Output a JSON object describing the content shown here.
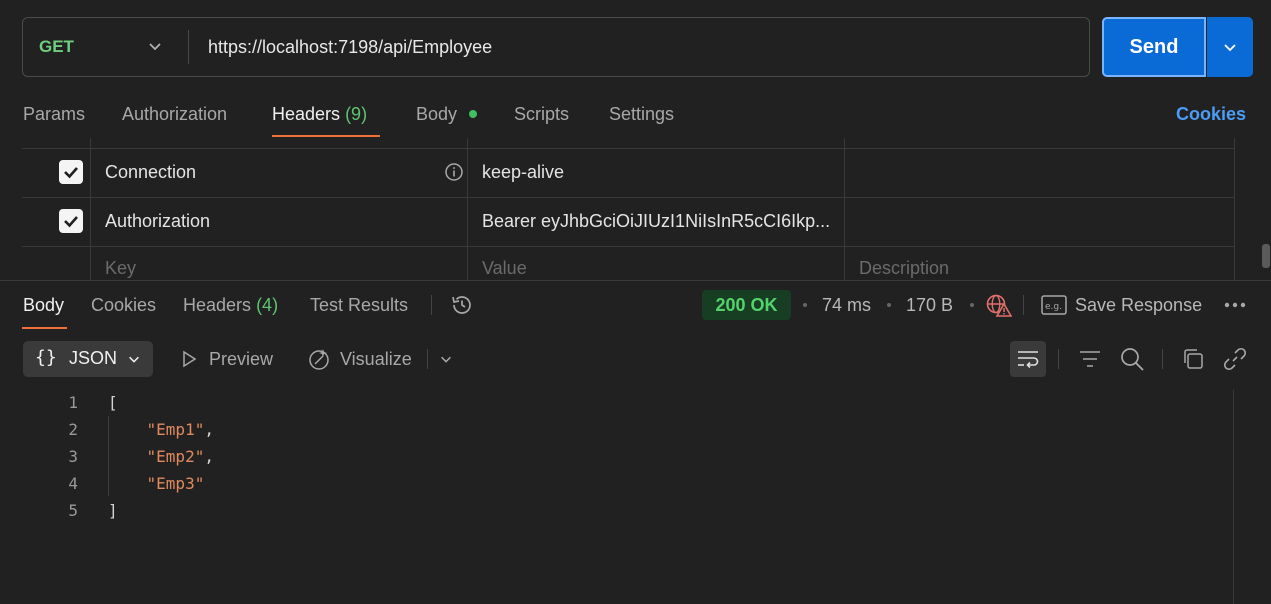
{
  "request": {
    "method": "GET",
    "url": "https://localhost:7198/api/Employee",
    "send_label": "Send"
  },
  "request_tabs": [
    {
      "label": "Params"
    },
    {
      "label": "Authorization"
    },
    {
      "label": "Headers",
      "count": "(9)"
    },
    {
      "label": "Body"
    },
    {
      "label": "Scripts"
    },
    {
      "label": "Settings"
    }
  ],
  "cookies_link": "Cookies",
  "headers_table": {
    "rows": [
      {
        "checked": true,
        "key": "Connection",
        "value": "keep-alive"
      },
      {
        "checked": true,
        "key": "Authorization",
        "value": "Bearer eyJhbGciOiJIUzI1NiIsInR5cCI6Ikp..."
      }
    ],
    "placeholders": {
      "key": "Key",
      "value": "Value",
      "description": "Description"
    }
  },
  "response_tabs": [
    {
      "label": "Body"
    },
    {
      "label": "Cookies"
    },
    {
      "label": "Headers",
      "count": "(4)"
    },
    {
      "label": "Test Results"
    }
  ],
  "response_meta": {
    "status": "200 OK",
    "time": "74 ms",
    "size": "170 B",
    "save_response": "Save Response"
  },
  "viewer": {
    "format": "JSON",
    "preview": "Preview",
    "visualize": "Visualize"
  },
  "code_lines": [
    {
      "n": "1",
      "open": "[",
      "str": "",
      "tail": ""
    },
    {
      "n": "2",
      "open": "    ",
      "str": "\"Emp1\"",
      "tail": ","
    },
    {
      "n": "3",
      "open": "    ",
      "str": "\"Emp2\"",
      "tail": ","
    },
    {
      "n": "4",
      "open": "    ",
      "str": "\"Emp3\"",
      "tail": ""
    },
    {
      "n": "5",
      "open": "]",
      "str": "",
      "tail": ""
    }
  ],
  "colors": {
    "accent": "#0b6bd6",
    "tab_underline": "#f0703c",
    "method_get": "#6fcf7f",
    "status_ok": "#54d36b",
    "json_string": "#e08a5e",
    "link": "#4c9cf5"
  },
  "icons": [
    "chevron-down-icon",
    "info-icon",
    "check-icon",
    "history-icon",
    "globe-warning-icon",
    "save-example-icon",
    "more-icon",
    "braces-icon",
    "play-icon",
    "visualize-icon",
    "wrap-icon",
    "filter-icon",
    "search-icon",
    "copy-icon",
    "link-icon"
  ]
}
